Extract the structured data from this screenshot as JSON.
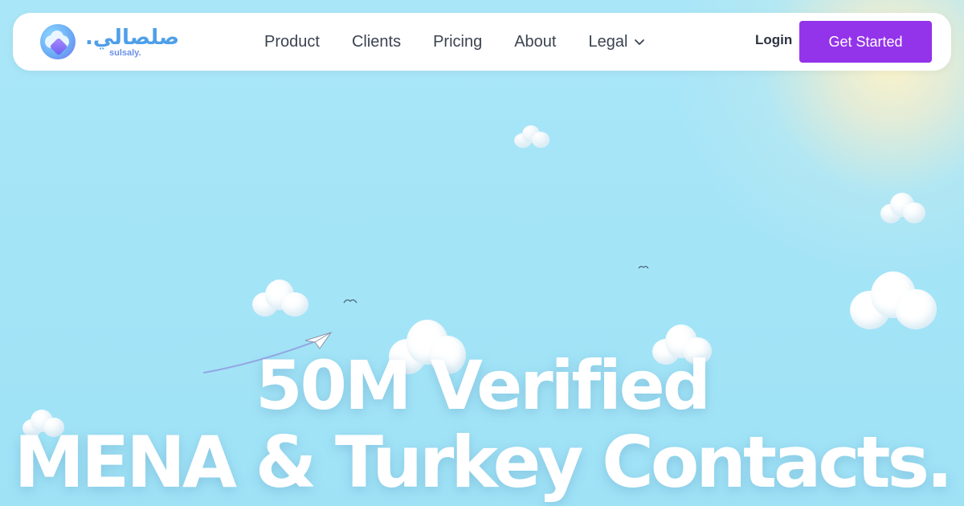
{
  "brand": {
    "name_ar": "صلصالي.",
    "name_en": "sulsaly."
  },
  "nav": {
    "items": [
      {
        "label": "Product"
      },
      {
        "label": "Clients"
      },
      {
        "label": "Pricing"
      },
      {
        "label": "About"
      },
      {
        "label": "Legal",
        "has_dropdown": true
      }
    ],
    "login_label": "Login",
    "cta_label": "Get Started"
  },
  "hero": {
    "headline_line1": "50M Verified",
    "headline_line2": "MENA & Turkey Contacts."
  },
  "colors": {
    "sky": "#a6e4f6",
    "accent": "#9333ea",
    "nav_text": "#3b4351",
    "headline": "#ffffff"
  },
  "icons": [
    "logo-cloud-icon",
    "chevron-down-icon",
    "paper-plane-icon",
    "bird-icon"
  ]
}
